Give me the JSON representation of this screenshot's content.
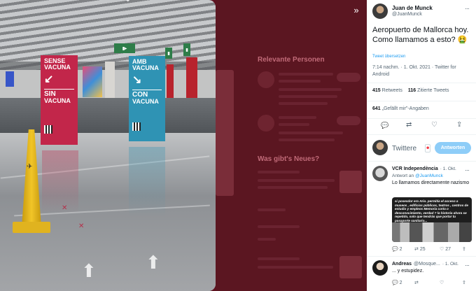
{
  "photo": {
    "banner_left": {
      "line1": "SENSE",
      "line2": "VACUNA",
      "line3": "SIN",
      "line4": "VACUNA"
    },
    "banner_right": {
      "line1": "AMB",
      "line2": "VACUNA",
      "line3": "CON",
      "line4": "VACUNA"
    }
  },
  "viewer": {
    "expand_icon": "»"
  },
  "background_timeline": {
    "relevant_heading": "Relevante Personen",
    "news_heading": "Was gibt's Neues?"
  },
  "tweet": {
    "author_name": "Juan de Munck",
    "author_handle": "@JuanMunck",
    "more_icon": "···",
    "text": "Aeropuerto de Mallorca hoy. Como llamamos a esto? 🤮",
    "emoji_line": "🤮",
    "translate_label": "Tweet übersetzen",
    "meta": "7:14 nachm. · 1. Okt. 2021 · Twitter for Android",
    "retweets_count": "415",
    "retweets_label": "Retweets",
    "quotes_count": "116",
    "quotes_label": "Zitierte Tweets",
    "likes_count": "641",
    "likes_label": "„Gefällt mir\"-Angaben"
  },
  "actions": {
    "reply_icon": "💬",
    "retweet_icon": "⇄",
    "like_icon": "♡",
    "share_icon": "⇪"
  },
  "compose": {
    "placeholder": "Twittere",
    "reply_button": "Antworten"
  },
  "replies": [
    {
      "name": "VCR Independència",
      "date": "· 1. Okt.",
      "reply_to_label": "Antwort an",
      "reply_to_handle": "@JuanMunck",
      "text": "Lo llamamos directamente nazismo",
      "image_caption": "si posesdor era Ario. permitia el acceso a museos , edificios públicos, teatros , centros de estudio y empleos Memoria corta o desconocimiento, verdad ? la historia ahora se repetido, solo que tendrás que portar tu pasaporte sanitario...",
      "replies": "2",
      "retweets": "25",
      "likes": "27"
    },
    {
      "name": "Andreas",
      "handle": "@Mosque...",
      "date": "· 1. Okt.",
      "text": "... y estupidez.",
      "replies": "2"
    }
  ]
}
